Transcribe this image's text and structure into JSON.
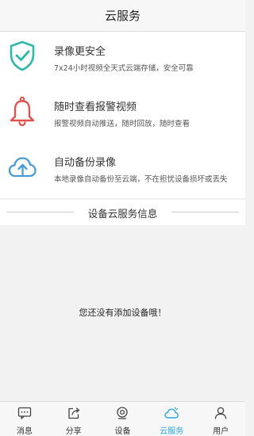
{
  "header": {
    "title": "云服务"
  },
  "features": [
    {
      "title": "录像更安全",
      "desc": "7x24小时视频全天式云端存储，安全可靠",
      "icon": "shield-check-icon",
      "color": "#2fb8a8"
    },
    {
      "title": "随时查看报警视频",
      "desc": "报警视频自动推送，随时回放，随时查看",
      "icon": "bell-icon",
      "color": "#e0524f"
    },
    {
      "title": "自动备份录像",
      "desc": "本地录像自动备份至云端，不在担忧设备损坏或丢失",
      "icon": "cloud-upload-icon",
      "color": "#4a9bd6"
    }
  ],
  "section": {
    "title": "设备云服务信息"
  },
  "empty": {
    "message": "您还没有添加设备哦！"
  },
  "tabs": [
    {
      "label": "消息",
      "icon": "message-icon"
    },
    {
      "label": "分享",
      "icon": "share-icon"
    },
    {
      "label": "设备",
      "icon": "device-icon"
    },
    {
      "label": "云服务",
      "icon": "cloud-icon",
      "active": true
    },
    {
      "label": "用户",
      "icon": "user-icon"
    }
  ],
  "colors": {
    "accent": "#2aa6d8"
  }
}
